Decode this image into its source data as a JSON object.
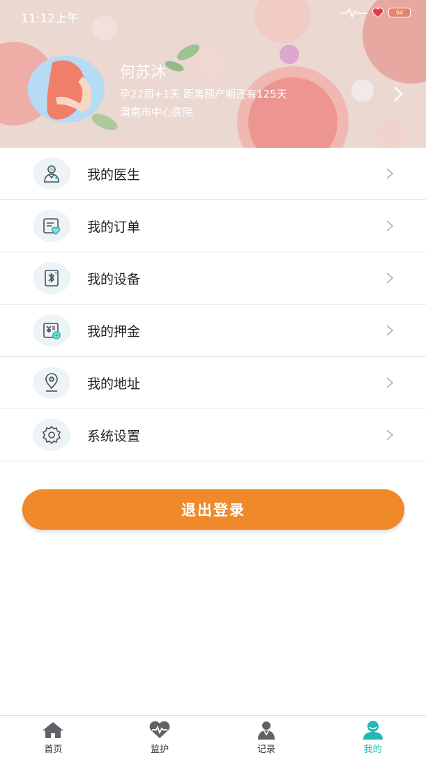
{
  "status": {
    "time": "11:12上午",
    "battery": "94"
  },
  "profile": {
    "name": "何苏沐",
    "pregnancy_status": "孕22周+1天  距离预产期还有125天",
    "hospital": "渭南市中心医院"
  },
  "menu": [
    {
      "label": "我的医生",
      "icon": "doctor-icon"
    },
    {
      "label": "我的订单",
      "icon": "order-icon"
    },
    {
      "label": "我的设备",
      "icon": "bluetooth-device-icon"
    },
    {
      "label": "我的押金",
      "icon": "deposit-icon"
    },
    {
      "label": "我的地址",
      "icon": "location-icon"
    },
    {
      "label": "系统设置",
      "icon": "gear-icon"
    }
  ],
  "logout_label": "退出登录",
  "bottom_nav": [
    {
      "label": "首页",
      "icon": "home-icon"
    },
    {
      "label": "监护",
      "icon": "heart-monitor-icon"
    },
    {
      "label": "记录",
      "icon": "record-doctor-icon"
    },
    {
      "label": "我的",
      "icon": "profile-icon",
      "active": true
    }
  ],
  "colors": {
    "accent_orange": "#f0892a",
    "active_teal": "#20b9b3",
    "icon_bg": "#edf4f7"
  }
}
